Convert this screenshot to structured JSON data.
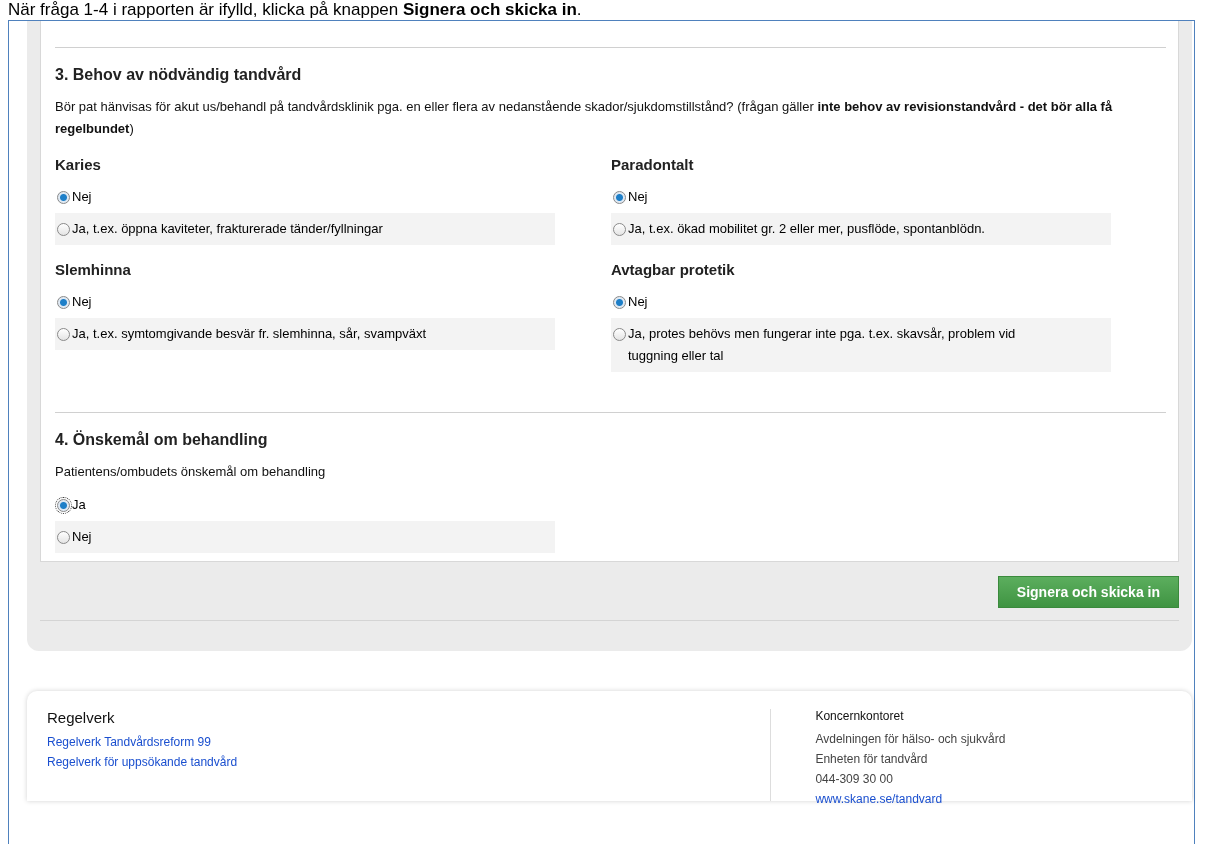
{
  "caption": "När fråga 1-4 i rapporten är ifylld, klicka på knappen **Signera och skicka in**.",
  "sections": [
    {
      "title": "3. Behov av nödvändig tandvård",
      "question": "Bör pat hänvisas för akut us/behandl på tandvårdsklinik pga. en eller flera av nedanstående skador/sjukdomstillstånd? (frågan gäller **inte behov av revisionstandvård - det bör alla få regelbundet**)",
      "groups": [
        {
          "title": "Karies",
          "options": [
            {
              "label": "Nej",
              "selected": true
            },
            {
              "label": "Ja, t.ex. öppna kaviteter, frakturerade tänder/fyllningar",
              "selected": false
            }
          ]
        },
        {
          "title": "Paradontalt",
          "options": [
            {
              "label": "Nej",
              "selected": true
            },
            {
              "label": "Ja, t.ex. ökad mobilitet gr. 2 eller mer, pusflöde, spontanblödn.",
              "selected": false
            }
          ]
        },
        {
          "title": "Slemhinna",
          "options": [
            {
              "label": "Nej",
              "selected": true
            },
            {
              "label": "Ja, t.ex. symtomgivande besvär fr. slemhinna, sår, svampväxt",
              "selected": false
            }
          ]
        },
        {
          "title": "Avtagbar protetik",
          "options": [
            {
              "label": "Nej",
              "selected": true
            },
            {
              "label": "Ja, protes behövs men fungerar inte pga. t.ex. skavsår, problem vid tuggning eller tal",
              "selected": false
            }
          ]
        }
      ]
    },
    {
      "title": "4. Önskemål om behandling",
      "question": "Patientens/ombudets önskemål om behandling",
      "groups": [
        {
          "options": [
            {
              "label": "Ja",
              "selected": true,
              "focused": true
            },
            {
              "label": "Nej",
              "selected": false,
              "focused": false
            }
          ]
        }
      ]
    }
  ],
  "submit_button": "Signera och skicka in",
  "footer": {
    "left": {
      "title": "Regelverk",
      "links": [
        "Regelverk Tandvårdsreform 99",
        "Regelverk för uppsökande tandvård"
      ]
    },
    "right": {
      "title": "Koncernkontoret",
      "lines": [
        "Avdelningen för hälso- och sjukvård",
        "Enheten för tandvård",
        "044-309 30 00"
      ],
      "link": "www.skane.se/tandvard"
    }
  }
}
